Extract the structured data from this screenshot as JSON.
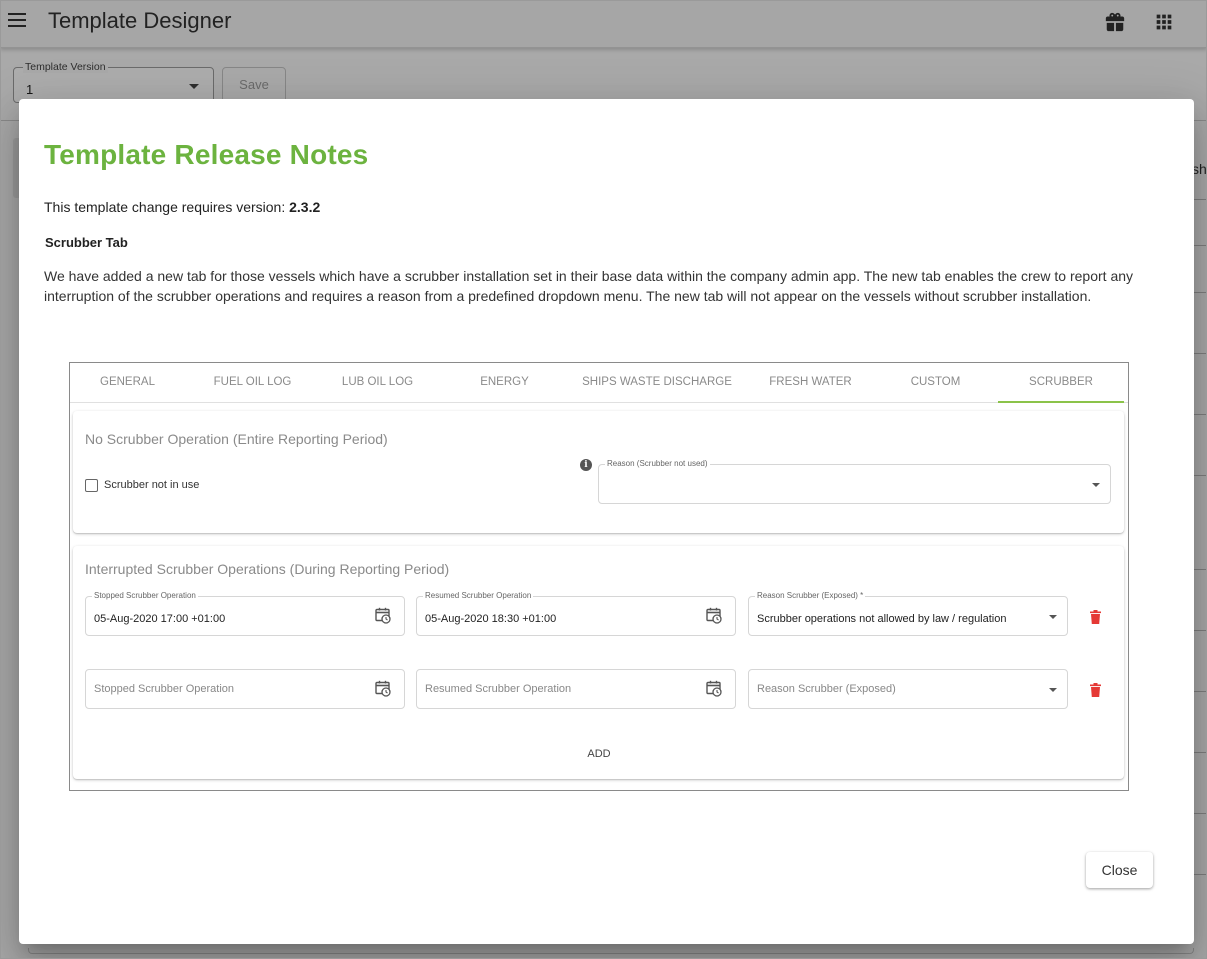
{
  "app": {
    "title": "Template Designer",
    "menu_icon": "hamburger-menu-icon",
    "gift_icon": "gift-icon",
    "apps_icon": "apps-grid-icon"
  },
  "toolbar": {
    "version_label": "Template Version",
    "version_value": "1",
    "save_label": "Save"
  },
  "background": {
    "right_cut_text": "sh"
  },
  "dialog": {
    "title": "Template Release Notes",
    "version_prefix": "This template change requires version: ",
    "version_value": "2.3.2",
    "section_title": "Scrubber Tab",
    "body": "We have added a new tab for those vessels which have a scrubber installation set in their base data within the company admin app. The new tab enables the crew to report any interruption of the scrubber operations and requires a reason from a predefined dropdown menu. The new tab will not appear on the vessels without scrubber installation.",
    "close_label": "Close"
  },
  "screenshot": {
    "tabs": [
      "GENERAL",
      "FUEL OIL LOG",
      "LUB OIL LOG",
      "ENERGY",
      "SHIPS WASTE DISCHARGE",
      "FRESH WATER",
      "CUSTOM",
      "SCRUBBER"
    ],
    "active_tab": "SCRUBBER",
    "no_operation": {
      "title": "No Scrubber Operation (Entire Reporting Period)",
      "checkbox_label": "Scrubber not in use",
      "checkbox_checked": false,
      "reason_label": "Reason (Scrubber not used)",
      "reason_value": ""
    },
    "interrupted": {
      "title": "Interrupted Scrubber Operations (During Reporting Period)",
      "rows": [
        {
          "stopped_label": "Stopped Scrubber Operation",
          "stopped_value": "05-Aug-2020 17:00 +01:00",
          "resumed_label": "Resumed Scrubber Operation",
          "resumed_value": "05-Aug-2020 18:30 +01:00",
          "reason_label": "Reason Scrubber (Exposed) *",
          "reason_value": "Scrubber operations not allowed by law / regulation"
        },
        {
          "stopped_placeholder": "Stopped Scrubber Operation",
          "resumed_placeholder": "Resumed Scrubber Operation",
          "reason_placeholder": "Reason Scrubber (Exposed)"
        }
      ],
      "add_label": "ADD"
    }
  },
  "colors": {
    "title_green": "#6cb33f",
    "tab_indicator": "#8bc34a",
    "delete_red": "#e53935"
  }
}
